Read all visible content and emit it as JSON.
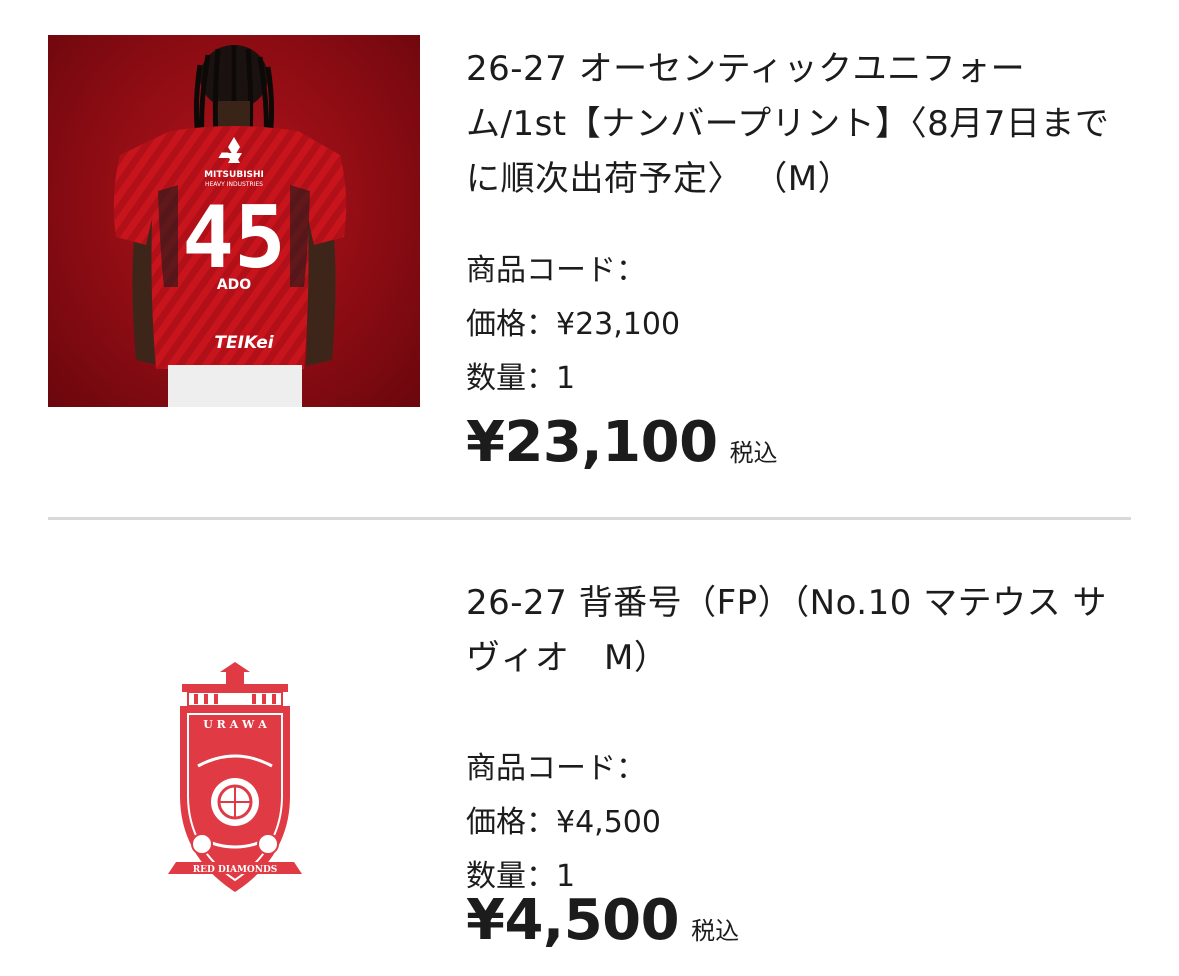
{
  "items": [
    {
      "title": "26-27 オーセンティックユニフォーム/1st【ナンバープリント】〈8月7日までに順次出荷予定〉 （M）",
      "code_label": "商品コード：",
      "price_label": "価格：¥23,100",
      "qty_label": "数量：1",
      "total": "¥23,100",
      "tax": "税込",
      "image": {
        "shirt_number": "45",
        "player_name": "ADO",
        "sponsor_top_1": "MITSUBISHI",
        "sponsor_top_2": "HEAVY INDUSTRIES",
        "sponsor_bottom": "TEIKei"
      }
    },
    {
      "title": "26-27 背番号（FP）（No.10 マテウス サヴィオ　M）",
      "code_label": "商品コード：",
      "price_label": "価格：¥4,500",
      "qty_label": "数量：1",
      "total": "¥4,500",
      "tax": "税込",
      "image": {
        "crest_top": "U R A W A",
        "crest_bottom": "RED DIAMONDS"
      }
    }
  ],
  "colors": {
    "brand_red": "#c8102e",
    "text": "#1c1c1c",
    "divider": "#d9d9d9"
  }
}
